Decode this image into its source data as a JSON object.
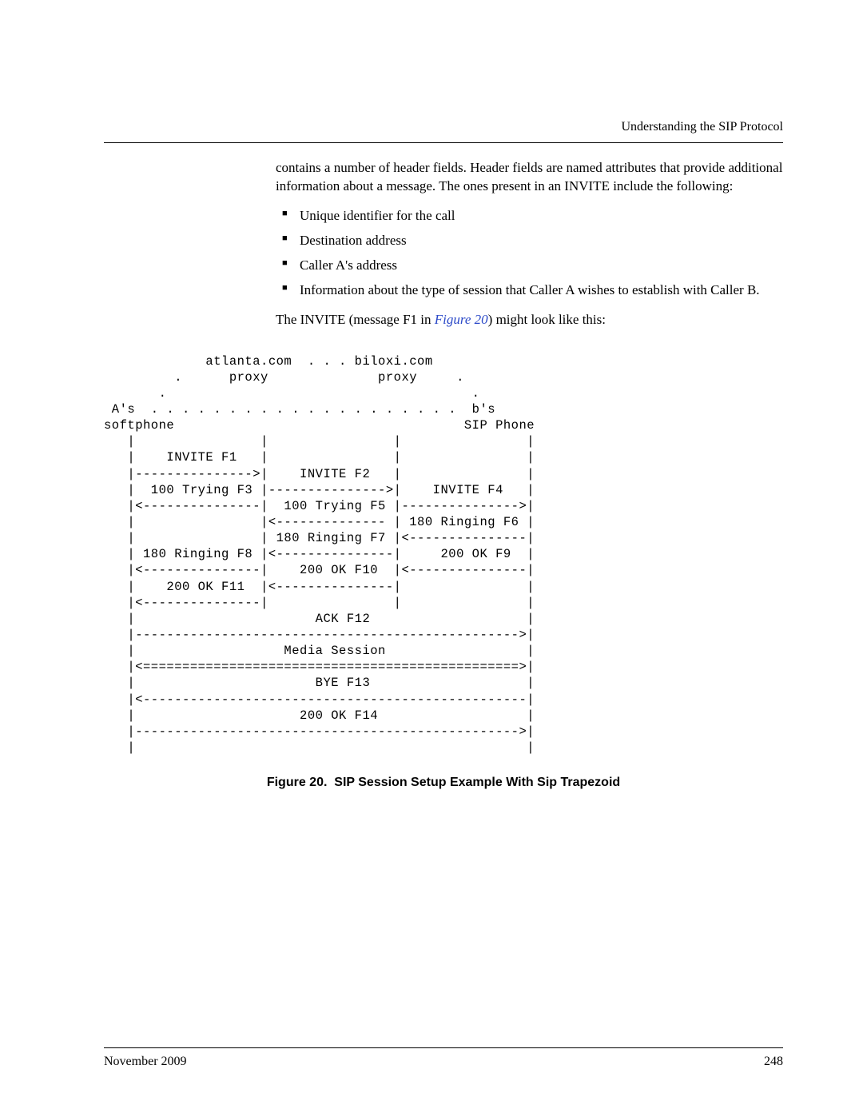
{
  "header": {
    "section_title": "Understanding the SIP Protocol"
  },
  "body": {
    "para1": "contains a number of header fields. Header fields are named attributes that provide additional information about a message. The ones present in an INVITE include the following:",
    "bullets": [
      "Unique identifier for the call",
      "Destination address",
      "Caller A's address",
      "Information about the type of session that Caller A wishes to establish with Caller B."
    ],
    "para2_pre": "The INVITE (message F1 in ",
    "para2_link": "Figure 20",
    "para2_post": ") might look like this:"
  },
  "diagram_text": "             atlanta.com  . . . biloxi.com\n         .      proxy              proxy     .\n       .                                       .\n A's  . . . . . . . . . . . . . . . . . . . .  b's\nsoftphone                                     SIP Phone\n   |                |                |                |\n   |    INVITE F1   |                |                |\n   |--------------->|    INVITE F2   |                |\n   |  100 Trying F3 |--------------->|    INVITE F4   |\n   |<---------------|  100 Trying F5 |--------------->|\n   |                |<-------------- | 180 Ringing F6 |\n   |                | 180 Ringing F7 |<---------------|\n   | 180 Ringing F8 |<---------------|     200 OK F9  |\n   |<---------------|    200 OK F10  |<---------------|\n   |    200 OK F11  |<---------------|                |\n   |<---------------|                |                |\n   |                       ACK F12                    |\n   |------------------------------------------------->|\n   |                   Media Session                  |\n   |<================================================>|\n   |                       BYE F13                    |\n   |<-------------------------------------------------|\n   |                     200 OK F14                   |\n   |------------------------------------------------->|\n   |                                                  |",
  "figure": {
    "label": "Figure 20.",
    "caption": "SIP Session Setup Example With Sip Trapezoid"
  },
  "footer": {
    "date": "November 2009",
    "page": "248"
  }
}
